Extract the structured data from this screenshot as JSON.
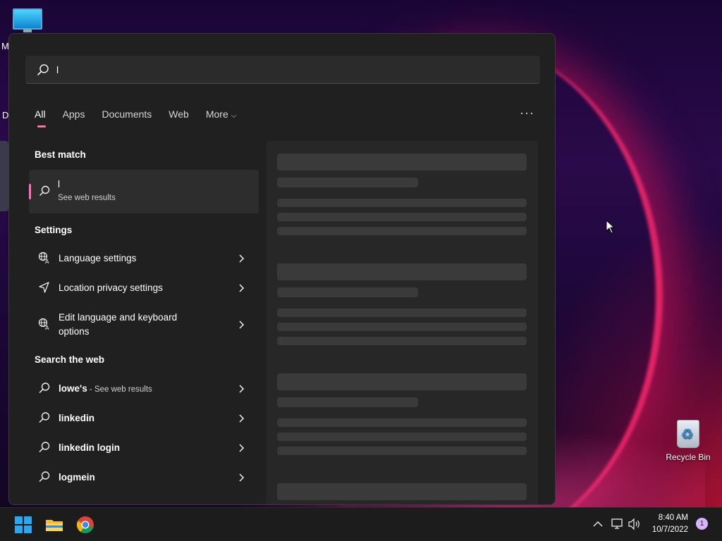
{
  "desktop": {
    "edge_letters": [
      "M",
      "Da"
    ],
    "recycle_bin_label": "Recycle Bin"
  },
  "search": {
    "query": "l",
    "tabs": [
      {
        "label": "All",
        "active": true
      },
      {
        "label": "Apps"
      },
      {
        "label": "Documents"
      },
      {
        "label": "Web"
      },
      {
        "label": "More"
      }
    ],
    "best_match": {
      "title": "Best match",
      "name": "l",
      "sub": "See web results"
    },
    "settings": {
      "title": "Settings",
      "items": [
        {
          "label": "Language settings",
          "icon": "language-icon"
        },
        {
          "label": "Location privacy settings",
          "icon": "location-icon"
        },
        {
          "label": "Edit language and keyboard options",
          "icon": "language-icon"
        }
      ]
    },
    "web": {
      "title": "Search the web",
      "items": [
        {
          "label": "lowe's",
          "sub": " - See web results"
        },
        {
          "label": "linkedin"
        },
        {
          "label": "linkedin login"
        },
        {
          "label": "logmein"
        }
      ]
    }
  },
  "taskbar": {
    "icons": [
      "start-icon",
      "file-explorer-icon",
      "chrome-icon"
    ],
    "time": "8:40 AM",
    "date": "10/7/2022",
    "notification_count": "1"
  },
  "colors": {
    "accent": "#ff70b4",
    "panel": "#202020"
  }
}
